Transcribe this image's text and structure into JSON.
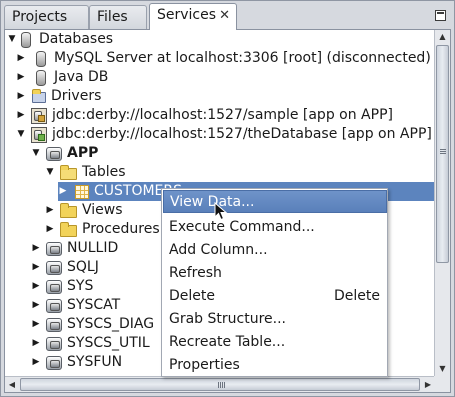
{
  "tabs": [
    {
      "label": "Projects"
    },
    {
      "label": "Files"
    },
    {
      "label": "Services",
      "close": "✕"
    }
  ],
  "tree": {
    "databases": "Databases",
    "mysql": "MySQL Server at localhost:3306 [root] (disconnected)",
    "javadb": "Java DB",
    "drivers": "Drivers",
    "conn_sample": "jdbc:derby://localhost:1527/sample [app on APP]",
    "conn_thedb": "jdbc:derby://localhost:1527/theDatabase [app on APP]",
    "schema_app": "APP",
    "tables": "Tables",
    "customers": "CUSTOMERS",
    "views": "Views",
    "procedures": "Procedures",
    "schemas": [
      "NULLID",
      "SQLJ",
      "SYS",
      "SYSCAT",
      "SYSCS_DIAG",
      "SYSCS_UTIL",
      "SYSFUN"
    ]
  },
  "context_menu": {
    "items": [
      {
        "label": "View Data..."
      },
      {
        "label": "Execute Command..."
      },
      {
        "label": "Add Column..."
      },
      {
        "label": "Refresh"
      },
      {
        "label": "Delete",
        "shortcut": "Delete"
      },
      {
        "label": "Grab Structure..."
      },
      {
        "label": "Recreate Table..."
      },
      {
        "label": "Properties"
      }
    ]
  },
  "colors": {
    "selection": "#5c84be",
    "menu_hover": "#5a80ba"
  }
}
